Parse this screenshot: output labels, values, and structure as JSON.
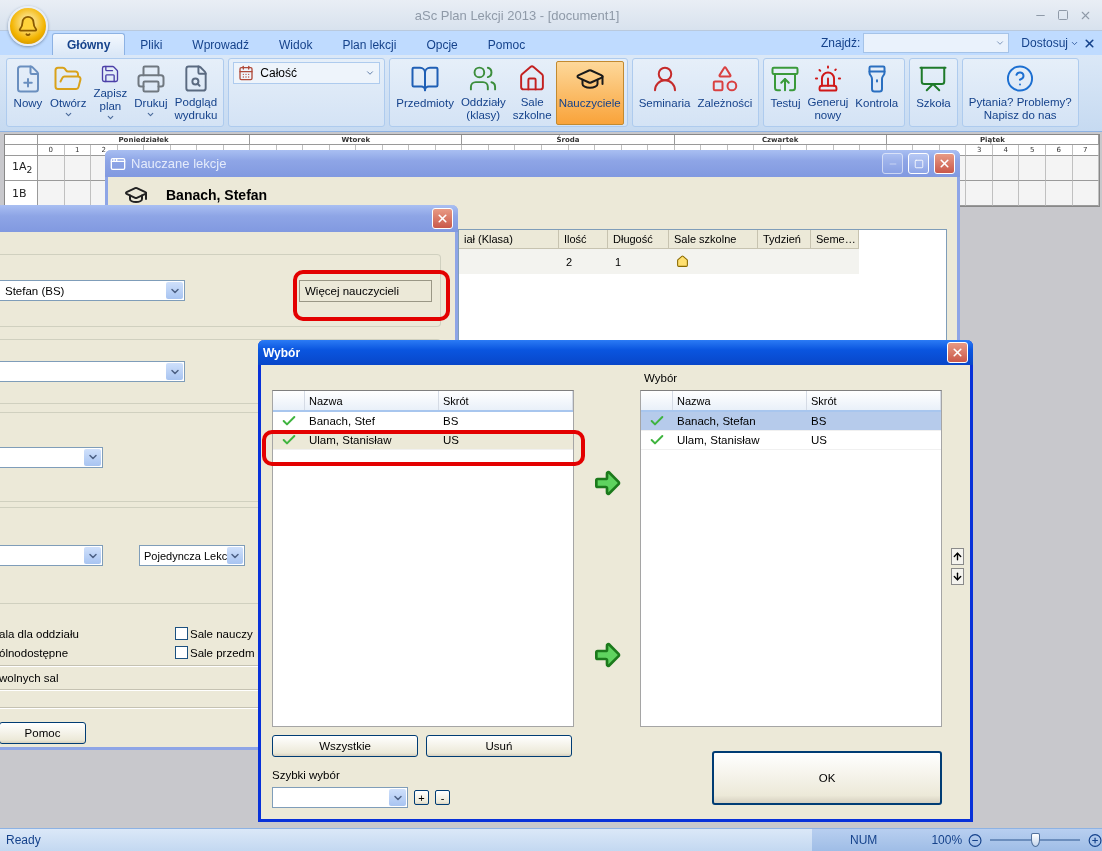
{
  "app": {
    "title": "aSc Plan Lekcji 2013  - [document1]"
  },
  "menu_tabs": [
    {
      "label": "Główny",
      "selected": true
    },
    {
      "label": "Pliki",
      "selected": false
    },
    {
      "label": "Wprowadź",
      "selected": false
    },
    {
      "label": "Widok",
      "selected": false
    },
    {
      "label": "Plan lekcji",
      "selected": false
    },
    {
      "label": "Opcje",
      "selected": false
    },
    {
      "label": "Pomoc",
      "selected": false
    }
  ],
  "find": {
    "label": "Znajdź:"
  },
  "customize": {
    "label": "Dostosuj"
  },
  "ribbon": {
    "groups": [
      {
        "items": [
          {
            "kind": "button",
            "label": "Nowy",
            "menu": false,
            "selected": false
          },
          {
            "kind": "button",
            "label": "Otwórz",
            "menu": true,
            "selected": false
          },
          {
            "kind": "button",
            "label": "Zapisz\nplan",
            "menu": true,
            "selected": false
          },
          {
            "kind": "button",
            "label": "Drukuj",
            "menu": true,
            "selected": false
          },
          {
            "kind": "button",
            "label": "Podgląd\nwydruku",
            "menu": false,
            "selected": false
          }
        ]
      },
      {
        "items": [
          {
            "kind": "combo",
            "label": "Całość"
          }
        ]
      },
      {
        "items": [
          {
            "kind": "button",
            "label": "Przedmioty",
            "menu": false,
            "selected": false
          },
          {
            "kind": "button",
            "label": "Oddziały\n(klasy)",
            "menu": false,
            "selected": false
          },
          {
            "kind": "button",
            "label": "Sale\nszkolne",
            "menu": false,
            "selected": false
          },
          {
            "kind": "button",
            "label": "Nauczyciele",
            "menu": false,
            "selected": true
          }
        ]
      },
      {
        "items": [
          {
            "kind": "button",
            "label": "Seminaria",
            "menu": false,
            "selected": false
          },
          {
            "kind": "button",
            "label": "Zależności",
            "menu": false,
            "selected": false
          }
        ]
      },
      {
        "items": [
          {
            "kind": "button",
            "label": "Testuj",
            "menu": false,
            "selected": false
          },
          {
            "kind": "button",
            "label": "Generuj\nnowy",
            "menu": false,
            "selected": false
          },
          {
            "kind": "button",
            "label": "Kontrola",
            "menu": false,
            "selected": false
          }
        ]
      },
      {
        "items": [
          {
            "kind": "button",
            "label": "Szkoła",
            "menu": false,
            "selected": false
          }
        ]
      },
      {
        "items": [
          {
            "kind": "button",
            "label": "Pytania? Problemy?\nNapisz do nas",
            "menu": false,
            "selected": false
          }
        ]
      }
    ]
  },
  "timetable": {
    "days": [
      {
        "name": "Poniedziałek",
        "periods": [
          "0",
          "1",
          "2"
        ]
      },
      {
        "name": "Wtorek"
      },
      {
        "name": "Środa"
      },
      {
        "name": "Czwartek"
      },
      {
        "name": "Piątek",
        "periods": [
          "3",
          "4",
          "5",
          "6",
          "7"
        ]
      }
    ],
    "rows": [
      "1A$_{2}$",
      "1B"
    ]
  },
  "lessons_window": {
    "title": "Nauczane lekcje",
    "teacher": "Banach, Stefan",
    "columns": [
      "iał (Klasa)",
      "Ilość",
      "Długość",
      "Sale szkolne",
      "Tydzień",
      "Seme…"
    ],
    "rows": [
      {
        "count": "2",
        "length": "1"
      }
    ]
  },
  "lesson_dialog": {
    "teacher_select": "Stefan (BS)",
    "more_teachers_button": "Więcej nauczycieli",
    "lesson_type_select": "Pojedyncza Lekc",
    "options": [
      "ala dla oddziału",
      "ólnodostępne"
    ],
    "checkboxes": [
      {
        "label": "Sale nauczy",
        "checked": false
      },
      {
        "label": "Sale przedm",
        "checked": false
      }
    ],
    "free_rooms": "wolnych sal",
    "help_button": "Pomoc"
  },
  "choice_dialog": {
    "title": "Wybór",
    "columns": [
      "Nazwa",
      "Skrót"
    ],
    "available": [
      {
        "name": "Banach, Stef",
        "short": "BS",
        "checked": true,
        "selected": false
      },
      {
        "name": "Ulam, Stanisław",
        "short": "US",
        "checked": true,
        "selected": true
      }
    ],
    "chosen_label": "Wybór",
    "chosen_columns": [
      "Nazwa",
      "Skrót"
    ],
    "chosen": [
      {
        "name": "Banach, Stefan",
        "short": "BS",
        "checked": true,
        "selected": true
      },
      {
        "name": "Ulam, Stanisław",
        "short": "US",
        "checked": true,
        "selected": false
      }
    ],
    "all_button": "Wszystkie",
    "remove_button": "Usuń",
    "quick_label": "Szybki wybór",
    "add_button": "+",
    "minus_button": "-",
    "ok_button": "OK"
  },
  "status_bar": {
    "text": "Ready",
    "num": "NUM",
    "zoom": "100%",
    "zoom_slider": {
      "level": 0.5
    }
  }
}
